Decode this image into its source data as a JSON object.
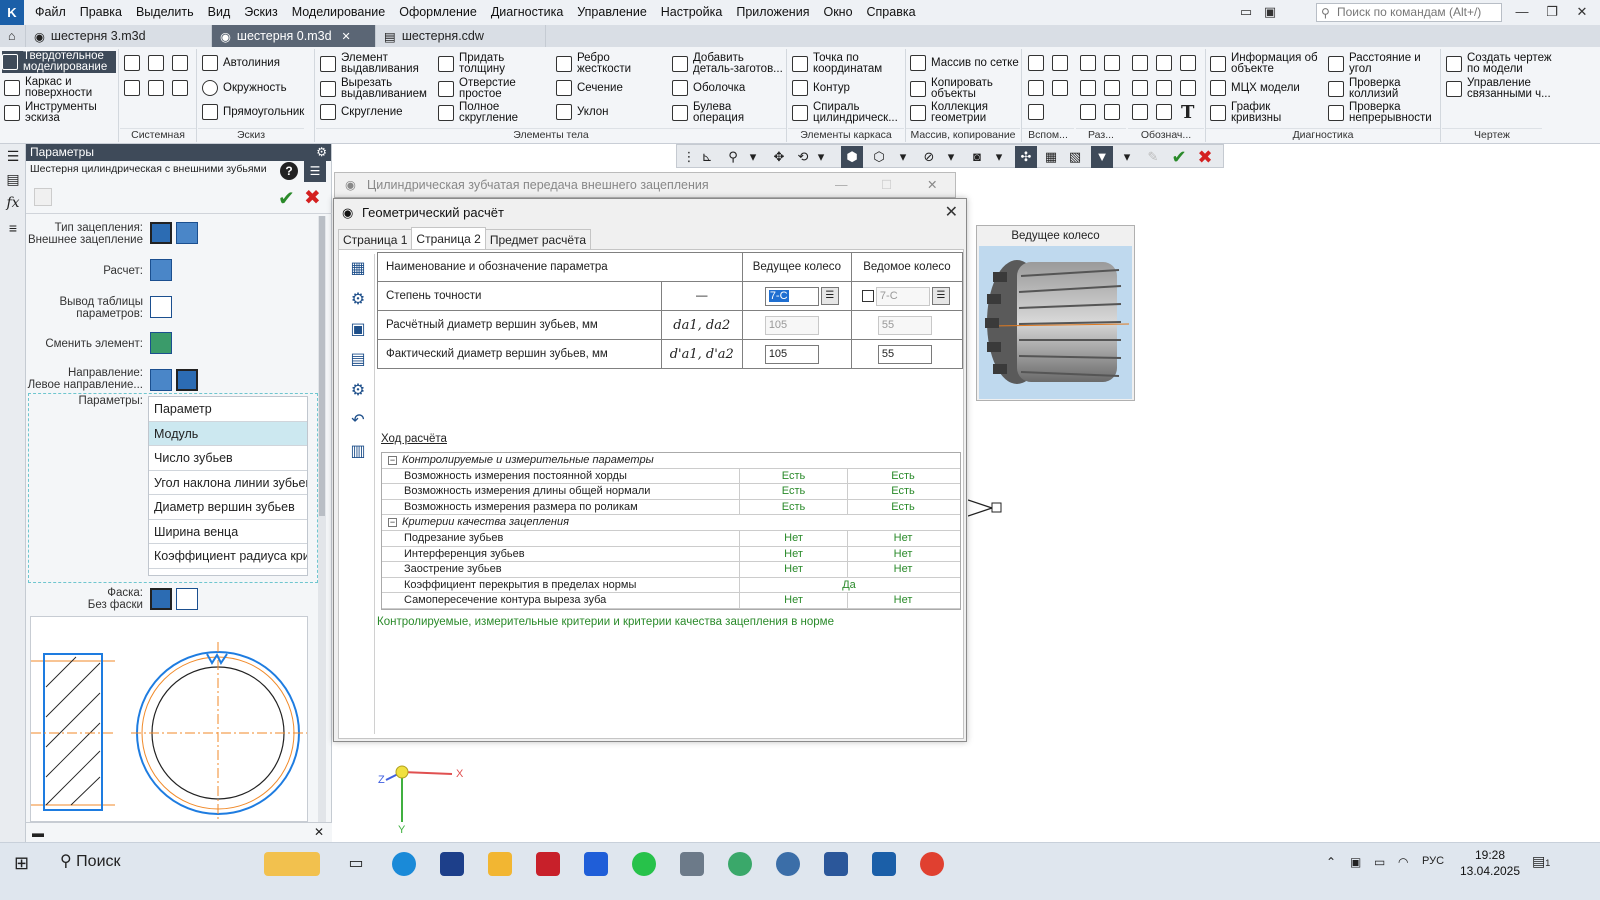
{
  "menubar": {
    "logo": "K",
    "items": [
      "Файл",
      "Правка",
      "Выделить",
      "Вид",
      "Эскиз",
      "Моделирование",
      "Оформление",
      "Диагностика",
      "Управление",
      "Настройка",
      "Приложения",
      "Окно",
      "Справка"
    ],
    "search_placeholder": "Поиск по командам (Alt+/)"
  },
  "tabs": [
    {
      "label": "шестерня 3.m3d",
      "active": false
    },
    {
      "label": "шестерня 0.m3d",
      "active": true
    },
    {
      "label": "шестерня.cdw",
      "active": false
    }
  ],
  "ribbon": {
    "mode1": "Твердотельное моделирование",
    "mode2": "Каркас и поверхности",
    "mode3": "Инструменты эскиза",
    "b_autoline": "Автолиния",
    "b_circle": "Окружность",
    "b_rect": "Прямоугольник",
    "b_extrude": "Элемент выдавливания",
    "b_cut": "Вырезать выдавливанием",
    "b_fillet": "Скругление",
    "b_thicken": "Придать толщину",
    "b_hole": "Отверстие простое",
    "b_fullfillet": "Полное скругление",
    "b_rib": "Ребро жесткости",
    "b_section": "Сечение",
    "b_draft": "Уклон",
    "b_addpart": "Добавить деталь-заготов...",
    "b_shell": "Оболочка",
    "b_bool": "Булева операция",
    "b_point": "Точка по координатам",
    "b_contour": "Контур",
    "b_spiral": "Спираль цилиндрическ...",
    "b_array": "Массив по сетке",
    "b_copy": "Копировать объекты",
    "b_collection": "Коллекция геометрии",
    "b_info": "Информация об объекте",
    "b_mcx": "МЦХ модели",
    "b_curv": "График кривизны",
    "b_dist": "Расстояние и угол",
    "b_coll": "Проверка коллизий",
    "b_cont": "Проверка непрерывности",
    "b_drawing": "Создать чертеж по модели",
    "b_links": "Управление связанными ч...",
    "groups": {
      "system": "Системная",
      "sketch": "Эскиз",
      "body": "Элементы тела",
      "frame": "Элементы каркаса",
      "array": "Массив, копирование",
      "aux": "Вспом...",
      "raz": "Раз...",
      "desig": "Обознач...",
      "diag": "Диагностика",
      "draw": "Чертеж"
    }
  },
  "params_panel": {
    "header": "Параметры",
    "subtitle": "Шестерня цилиндрическая с внешними зубьями",
    "mesh_type_label": "Тип зацепления:",
    "mesh_type_value": "Внешнее зацепление",
    "calc_label": "Расчет:",
    "table_label": "Вывод таблицы параметров:",
    "change_label": "Сменить элемент:",
    "direction_label": "Направление:",
    "direction_value": "Левое направление...",
    "params_label": "Параметры:",
    "list": [
      "Параметр",
      "Модуль",
      "Число зубьев",
      "Угол наклона линии зубьев",
      "Диаметр вершин зубьев",
      "Ширина венца",
      "Коэффициент радиуса криви"
    ],
    "chamfer_label": "Фаска:",
    "chamfer_value": "Без фаски"
  },
  "bg_dialog": {
    "title": "Цилиндрическая зубчатая передача внешнего зацепления"
  },
  "dialog": {
    "title": "Геометрический расчёт",
    "tabs": [
      "Страница 1",
      "Страница 2",
      "Предмет расчёта"
    ],
    "table": {
      "h_name": "Наименование и обозначение параметра",
      "h_drive": "Ведущее колесо",
      "h_driven": "Ведомое колесо",
      "rows": [
        {
          "name": "Степень точности",
          "sym": "—",
          "drive": "7-C",
          "driven": "7-C"
        },
        {
          "name": "Расчётный диаметр вершин зубьев, мм",
          "sym": "da1, da2",
          "drive": "105",
          "driven": "55"
        },
        {
          "name": "Фактический диаметр вершин зубьев, мм",
          "sym": "d'a1, d'a2",
          "drive": "105",
          "driven": "55"
        }
      ]
    },
    "calc_link": "Ход расчёта",
    "groups": [
      {
        "title": "Контролируемые и измерительные параметры",
        "rows": [
          {
            "name": "Возможность измерения постоянной хорды",
            "a": "Есть",
            "b": "Есть"
          },
          {
            "name": "Возможность измерения длины общей нормали",
            "a": "Есть",
            "b": "Есть"
          },
          {
            "name": "Возможность измерения размера по роликам",
            "a": "Есть",
            "b": "Есть"
          }
        ]
      },
      {
        "title": "Критерии качества зацепления",
        "rows": [
          {
            "name": "Подрезание зубьев",
            "a": "Нет",
            "b": "Нет"
          },
          {
            "name": "Интерференция зубьев",
            "a": "Нет",
            "b": "Нет"
          },
          {
            "name": "Заострение зубьев",
            "a": "Нет",
            "b": "Нет"
          },
          {
            "name": "Коэффициент перекрытия в пределах нормы",
            "ab": "Да"
          },
          {
            "name": "Самопересечение контура выреза зуба",
            "a": "Нет",
            "b": "Нет"
          }
        ]
      }
    ],
    "status": "Контролируемые, измерительные критерии и критерии качества зацепления в норме"
  },
  "wheel_preview": {
    "title": "Ведущее колесо"
  },
  "axes": {
    "x": "X",
    "y": "Y",
    "z": "Z"
  },
  "taskbar": {
    "search": "Поиск",
    "lang": "РУС",
    "time": "19:28",
    "date": "13.04.2025",
    "notif": "1"
  },
  "colors": {
    "accent": "#1b5fa8",
    "ok": "#2a8a2a",
    "cancel": "#d42020",
    "highlight": "#1f6fd1"
  }
}
